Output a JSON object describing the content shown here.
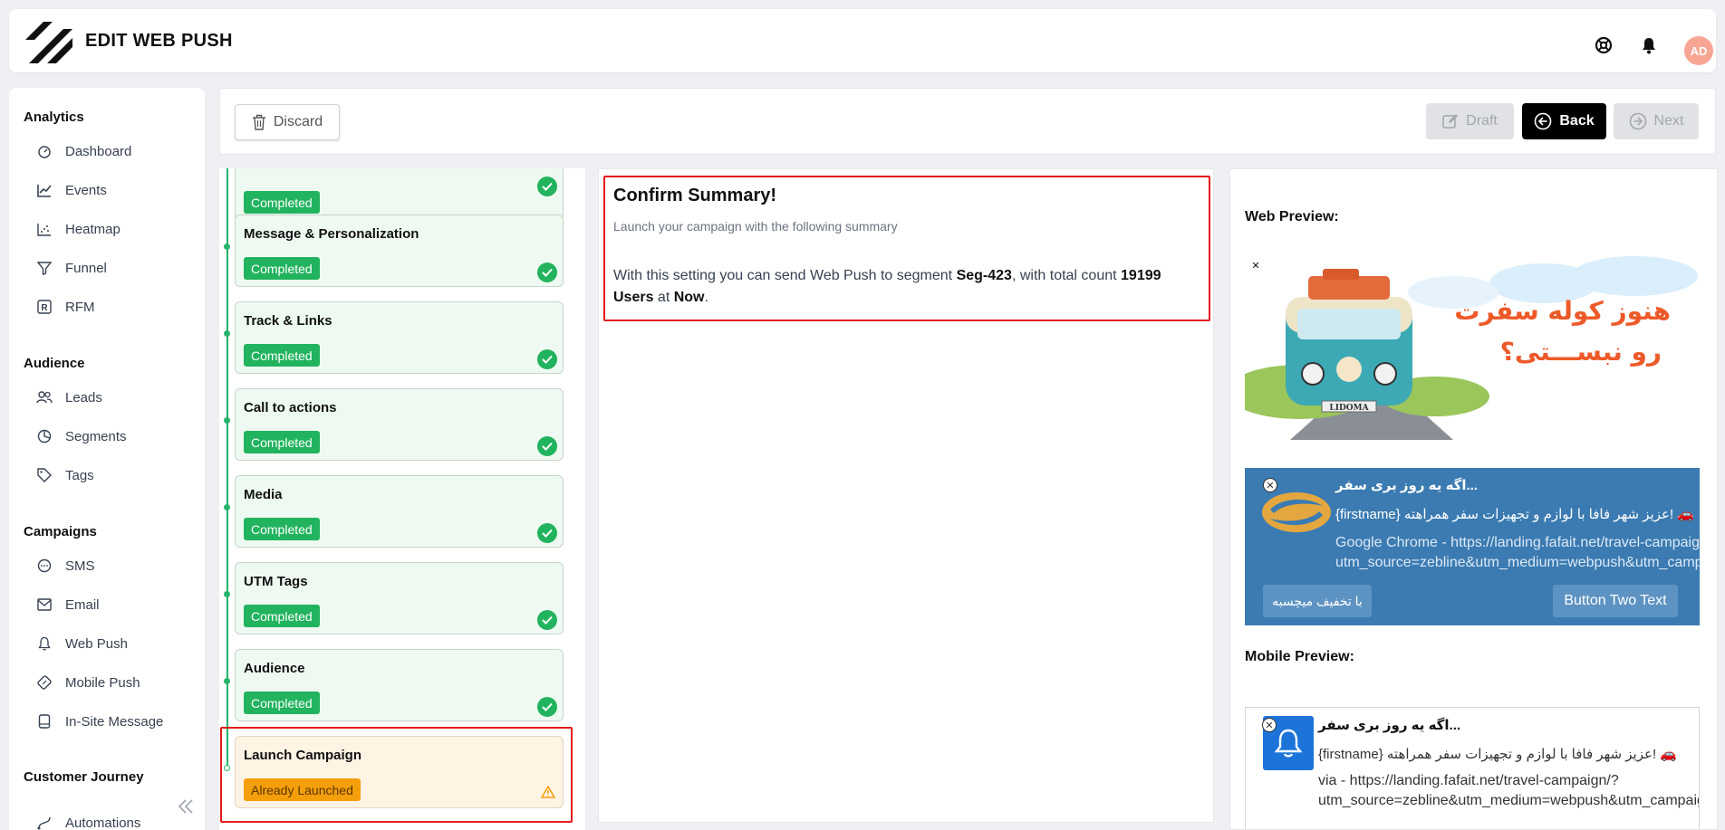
{
  "header": {
    "title": "EDIT WEB PUSH",
    "avatar_initials": "AD"
  },
  "colors": {
    "accent": "#22b35e",
    "warning": "#f59e0b",
    "highlight": "#e41b1b",
    "notif_bg": "#3b7bb2",
    "avatar": "#f8a593"
  },
  "sidebar": {
    "sections": [
      {
        "label": "Analytics",
        "items": [
          {
            "label": "Dashboard",
            "icon": "dashboard-icon"
          },
          {
            "label": "Events",
            "icon": "line-chart-icon"
          },
          {
            "label": "Heatmap",
            "icon": "heatmap-icon"
          },
          {
            "label": "Funnel",
            "icon": "funnel-icon"
          },
          {
            "label": "RFM",
            "icon": "rfm-icon"
          }
        ]
      },
      {
        "label": "Audience",
        "items": [
          {
            "label": "Leads",
            "icon": "users-icon"
          },
          {
            "label": "Segments",
            "icon": "pie-chart-icon"
          },
          {
            "label": "Tags",
            "icon": "tag-icon"
          }
        ]
      },
      {
        "label": "Campaigns",
        "items": [
          {
            "label": "SMS",
            "icon": "sms-icon"
          },
          {
            "label": "Email",
            "icon": "mail-icon"
          },
          {
            "label": "Web Push",
            "icon": "bell-icon"
          },
          {
            "label": "Mobile Push",
            "icon": "mobile-push-icon"
          },
          {
            "label": "In-Site Message",
            "icon": "in-site-message-icon"
          }
        ]
      },
      {
        "label": "Customer Journey",
        "items": [
          {
            "label": "Automations",
            "icon": "automation-icon"
          }
        ]
      }
    ]
  },
  "toolbar": {
    "discard_label": "Discard",
    "draft_label": "Draft",
    "back_label": "Back",
    "next_label": "Next"
  },
  "steps": [
    {
      "title": "",
      "status": "Completed"
    },
    {
      "title": "Message & Personalization",
      "status": "Completed"
    },
    {
      "title": "Track & Links",
      "status": "Completed"
    },
    {
      "title": "Call to actions",
      "status": "Completed"
    },
    {
      "title": "Media",
      "status": "Completed"
    },
    {
      "title": "UTM Tags",
      "status": "Completed"
    },
    {
      "title": "Audience",
      "status": "Completed"
    },
    {
      "title": "Launch Campaign",
      "status": "Already Launched"
    }
  ],
  "summary": {
    "title": "Confirm Summary!",
    "subtitle": "Launch your campaign with the following summary",
    "text_prefix": "With this setting you can send Web Push to segment ",
    "segment": "Seg-423",
    "text_mid": ", with total count ",
    "count": "19199 Users",
    "text_at": " at ",
    "time": "Now",
    "text_end": "."
  },
  "preview": {
    "web_label": "Web Preview:",
    "mobile_label": "Mobile Preview:",
    "image_text_line1": "هنوز کوله سفرت",
    "image_text_line2": "رو نبســـتی؟",
    "van_plate": "LIDOMA",
    "notif_title": "اگه یه روز بری سفر...",
    "notif_body": "{firstname} عزیز شهر فافا با لوازم و تجهیزات سفر همراهته! 🚗",
    "notif_url_line1": "Google Chrome - https://landing.fafait.net/travel-campaign/?",
    "notif_url_line2": "utm_source=zebline&utm_medium=webpush&utm_campaign",
    "notif_btn1": "با تخفیف میچسبه",
    "notif_btn2": "Button Two Text",
    "mobile_title": "اگه یه روز بری سفر...",
    "mobile_body": "{firstname} عزیز شهر فافا با لوازم و تجهیزات سفر همراهته! 🚗",
    "mobile_url_line1": "via - https://landing.fafait.net/travel-campaign/?",
    "mobile_url_line2": "utm_source=zebline&utm_medium=webpush&utm_campaign"
  }
}
